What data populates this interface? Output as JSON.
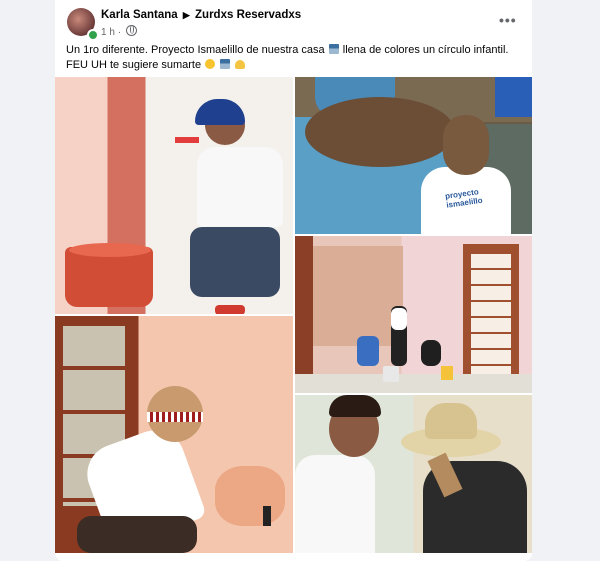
{
  "post": {
    "author": "Karla Santana",
    "group": "Zurdxs Reservadxs",
    "time": "1 h",
    "more_label": "•••",
    "text_line1_a": "Un 1ro diferente. Proyecto Ismaelillo de nuestra casa",
    "text_line1_b": "llena de colores un círculo infantil.",
    "text_line2": "FEU UH te sugiere sumarte",
    "shirt_text": "proyecto ismaelillo"
  },
  "photos": [
    {
      "name": "photo-man-painting-wall"
    },
    {
      "name": "photo-woman-painting-planter"
    },
    {
      "name": "photo-group-painting-room"
    },
    {
      "name": "photo-woman-painting-door-wall"
    },
    {
      "name": "photo-men-with-hat"
    }
  ],
  "colors": {
    "accent": "#31a24c",
    "text": "#050505",
    "secondary_text": "#65676b",
    "background": "#f0f2f5"
  }
}
